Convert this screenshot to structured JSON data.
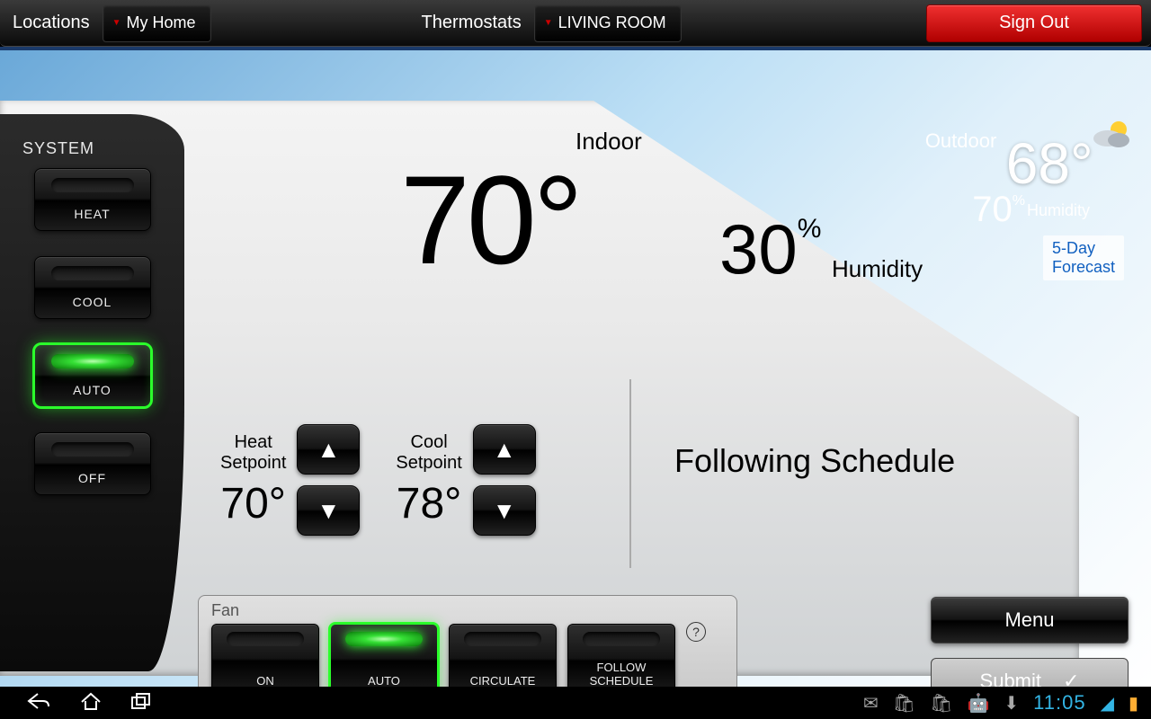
{
  "topbar": {
    "locations_label": "Locations",
    "location_value": "My Home",
    "thermostats_label": "Thermostats",
    "thermostat_value": "LIVING ROOM",
    "signout_label": "Sign Out"
  },
  "sidebar": {
    "title": "SYSTEM",
    "modes": [
      {
        "label": "HEAT",
        "active": false
      },
      {
        "label": "COOL",
        "active": false
      },
      {
        "label": "AUTO",
        "active": true
      },
      {
        "label": "OFF",
        "active": false
      }
    ]
  },
  "indoor": {
    "label": "Indoor",
    "temp": "70°",
    "humidity_value": "30",
    "humidity_pct": "%",
    "humidity_label": "Humidity"
  },
  "outdoor": {
    "label": "Outdoor",
    "temp": "68°",
    "humidity_value": "70",
    "humidity_pct": "%",
    "humidity_label": "Humidity",
    "forecast_link": "5-Day\nForecast"
  },
  "setpoints": {
    "heat": {
      "label1": "Heat",
      "label2": "Setpoint",
      "value": "70°"
    },
    "cool": {
      "label1": "Cool",
      "label2": "Setpoint",
      "value": "78°"
    }
  },
  "schedule_status": "Following Schedule",
  "fan": {
    "title": "Fan",
    "buttons": [
      {
        "label": "ON",
        "active": false
      },
      {
        "label": "AUTO",
        "active": true
      },
      {
        "label": "CIRCULATE",
        "active": false
      },
      {
        "label": "FOLLOW\nSCHEDULE",
        "active": false
      }
    ]
  },
  "actions": {
    "menu": "Menu",
    "submit": "Submit"
  },
  "navbar": {
    "clock": "11:05"
  }
}
